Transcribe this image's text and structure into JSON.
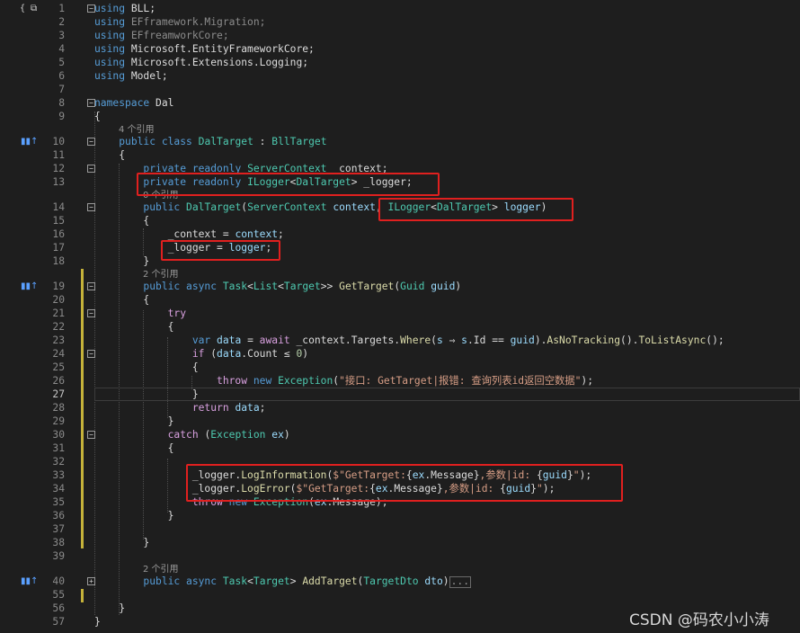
{
  "colors": {
    "background": "#1e1e1e",
    "keyword": "#569cd6",
    "control_keyword": "#d8a0df",
    "type": "#4ec9b0",
    "method": "#dcdcaa",
    "string": "#d69d85",
    "parameter": "#9cdcfe",
    "number": "#b5cea8",
    "highlight_box": "#e0201f"
  },
  "top_icon": "{ ⧉",
  "codelens": {
    "class_refs": "4 个引用",
    "ctor_refs": "0 个引用",
    "method_refs": "2 个引用",
    "add_refs": "2 个引用"
  },
  "lines": [
    {
      "n": "1",
      "t": [
        {
          "c": "kw",
          "v": "using"
        },
        {
          "c": "nm",
          "v": " BLL;"
        }
      ]
    },
    {
      "n": "2",
      "t": [
        {
          "c": "kw",
          "v": "using"
        },
        {
          "c": "gray",
          "v": " EFframework.Migration;"
        }
      ]
    },
    {
      "n": "3",
      "t": [
        {
          "c": "kw",
          "v": "using"
        },
        {
          "c": "gray",
          "v": " EFfreamworkCore;"
        }
      ]
    },
    {
      "n": "4",
      "t": [
        {
          "c": "kw",
          "v": "using"
        },
        {
          "c": "nm",
          "v": " Microsoft.EntityFrameworkCore;"
        }
      ]
    },
    {
      "n": "5",
      "t": [
        {
          "c": "kw",
          "v": "using"
        },
        {
          "c": "nm",
          "v": " Microsoft.Extensions.Logging;"
        }
      ]
    },
    {
      "n": "6",
      "t": [
        {
          "c": "kw",
          "v": "using"
        },
        {
          "c": "nm",
          "v": " Model;"
        }
      ]
    },
    {
      "n": "7",
      "t": []
    },
    {
      "n": "8",
      "t": [
        {
          "c": "kw",
          "v": "namespace"
        },
        {
          "c": "nm",
          "v": " Dal"
        }
      ]
    },
    {
      "n": "9",
      "t": [
        {
          "c": "nm",
          "v": "{"
        }
      ]
    },
    {
      "n": "10",
      "t": [
        {
          "c": "nm",
          "v": "    "
        },
        {
          "c": "kw",
          "v": "public class"
        },
        {
          "c": "nm",
          "v": " "
        },
        {
          "c": "ty",
          "v": "DalTarget"
        },
        {
          "c": "nm",
          "v": " : "
        },
        {
          "c": "ty",
          "v": "BllTarget"
        }
      ]
    },
    {
      "n": "11",
      "t": [
        {
          "c": "nm",
          "v": "    {"
        }
      ]
    },
    {
      "n": "12",
      "t": [
        {
          "c": "nm",
          "v": "        "
        },
        {
          "c": "kw",
          "v": "private readonly"
        },
        {
          "c": "nm",
          "v": " "
        },
        {
          "c": "ty",
          "v": "ServerContext"
        },
        {
          "c": "nm",
          "v": " _context;"
        }
      ]
    },
    {
      "n": "13",
      "t": [
        {
          "c": "nm",
          "v": "        "
        },
        {
          "c": "kw",
          "v": "private readonly"
        },
        {
          "c": "nm",
          "v": " "
        },
        {
          "c": "ty",
          "v": "ILogger"
        },
        {
          "c": "nm",
          "v": "<"
        },
        {
          "c": "ty",
          "v": "DalTarget"
        },
        {
          "c": "nm",
          "v": "> _logger;"
        }
      ]
    },
    {
      "n": "14",
      "t": [
        {
          "c": "nm",
          "v": "        "
        },
        {
          "c": "kw",
          "v": "public"
        },
        {
          "c": "nm",
          "v": " "
        },
        {
          "c": "ty",
          "v": "DalTarget"
        },
        {
          "c": "nm",
          "v": "("
        },
        {
          "c": "ty",
          "v": "ServerContext"
        },
        {
          "c": "nm",
          "v": " "
        },
        {
          "c": "pm",
          "v": "context"
        },
        {
          "c": "nm",
          "v": ", "
        },
        {
          "c": "ty",
          "v": "ILogger"
        },
        {
          "c": "nm",
          "v": "<"
        },
        {
          "c": "ty",
          "v": "DalTarget"
        },
        {
          "c": "nm",
          "v": "> "
        },
        {
          "c": "pm",
          "v": "logger"
        },
        {
          "c": "nm",
          "v": ")"
        }
      ]
    },
    {
      "n": "15",
      "t": [
        {
          "c": "nm",
          "v": "        {"
        }
      ]
    },
    {
      "n": "16",
      "t": [
        {
          "c": "nm",
          "v": "            _context = "
        },
        {
          "c": "pm",
          "v": "context"
        },
        {
          "c": "nm",
          "v": ";"
        }
      ]
    },
    {
      "n": "17",
      "t": [
        {
          "c": "nm",
          "v": "            _logger = "
        },
        {
          "c": "pm",
          "v": "logger"
        },
        {
          "c": "nm",
          "v": ";"
        }
      ]
    },
    {
      "n": "18",
      "t": [
        {
          "c": "nm",
          "v": "        }"
        }
      ]
    },
    {
      "n": "19",
      "t": [
        {
          "c": "nm",
          "v": "        "
        },
        {
          "c": "kw",
          "v": "public async"
        },
        {
          "c": "nm",
          "v": " "
        },
        {
          "c": "ty",
          "v": "Task"
        },
        {
          "c": "nm",
          "v": "<"
        },
        {
          "c": "ty",
          "v": "List"
        },
        {
          "c": "nm",
          "v": "<"
        },
        {
          "c": "ty",
          "v": "Target"
        },
        {
          "c": "nm",
          "v": ">> "
        },
        {
          "c": "fn",
          "v": "GetTarget"
        },
        {
          "c": "nm",
          "v": "("
        },
        {
          "c": "ty",
          "v": "Guid"
        },
        {
          "c": "nm",
          "v": " "
        },
        {
          "c": "pm",
          "v": "guid"
        },
        {
          "c": "nm",
          "v": ")"
        }
      ]
    },
    {
      "n": "20",
      "t": [
        {
          "c": "nm",
          "v": "        {"
        }
      ]
    },
    {
      "n": "21",
      "t": [
        {
          "c": "nm",
          "v": "            "
        },
        {
          "c": "ctl",
          "v": "try"
        }
      ]
    },
    {
      "n": "22",
      "t": [
        {
          "c": "nm",
          "v": "            {"
        }
      ]
    },
    {
      "n": "23",
      "t": [
        {
          "c": "nm",
          "v": "                "
        },
        {
          "c": "kw",
          "v": "var"
        },
        {
          "c": "nm",
          "v": " "
        },
        {
          "c": "pm",
          "v": "data"
        },
        {
          "c": "nm",
          "v": " = "
        },
        {
          "c": "ctl",
          "v": "await"
        },
        {
          "c": "nm",
          "v": " _context.Targets."
        },
        {
          "c": "fn",
          "v": "Where"
        },
        {
          "c": "nm",
          "v": "("
        },
        {
          "c": "pm",
          "v": "s"
        },
        {
          "c": "nm",
          "v": " ⇒ "
        },
        {
          "c": "pm",
          "v": "s"
        },
        {
          "c": "nm",
          "v": ".Id == "
        },
        {
          "c": "pm",
          "v": "guid"
        },
        {
          "c": "nm",
          "v": ")."
        },
        {
          "c": "fn",
          "v": "AsNoTracking"
        },
        {
          "c": "nm",
          "v": "()."
        },
        {
          "c": "fn",
          "v": "ToListAsync"
        },
        {
          "c": "nm",
          "v": "();"
        }
      ]
    },
    {
      "n": "24",
      "t": [
        {
          "c": "nm",
          "v": "                "
        },
        {
          "c": "ctl",
          "v": "if"
        },
        {
          "c": "nm",
          "v": " ("
        },
        {
          "c": "pm",
          "v": "data"
        },
        {
          "c": "nm",
          "v": ".Count ≤ "
        },
        {
          "c": "num",
          "v": "0"
        },
        {
          "c": "nm",
          "v": ")"
        }
      ]
    },
    {
      "n": "25",
      "t": [
        {
          "c": "nm",
          "v": "                {"
        }
      ]
    },
    {
      "n": "26",
      "t": [
        {
          "c": "nm",
          "v": "                    "
        },
        {
          "c": "ctl",
          "v": "throw"
        },
        {
          "c": "nm",
          "v": " "
        },
        {
          "c": "kw",
          "v": "new"
        },
        {
          "c": "nm",
          "v": " "
        },
        {
          "c": "ty",
          "v": "Exception"
        },
        {
          "c": "nm",
          "v": "("
        },
        {
          "c": "str",
          "v": "\"接口: GetTarget|报错: 查询列表id返回空数据\""
        },
        {
          "c": "nm",
          "v": ");"
        }
      ]
    },
    {
      "n": "27",
      "t": [
        {
          "c": "nm",
          "v": "                }"
        }
      ]
    },
    {
      "n": "28",
      "t": [
        {
          "c": "nm",
          "v": "                "
        },
        {
          "c": "ctl",
          "v": "return"
        },
        {
          "c": "nm",
          "v": " "
        },
        {
          "c": "pm",
          "v": "data"
        },
        {
          "c": "nm",
          "v": ";"
        }
      ]
    },
    {
      "n": "29",
      "t": [
        {
          "c": "nm",
          "v": "            }"
        }
      ]
    },
    {
      "n": "30",
      "t": [
        {
          "c": "nm",
          "v": "            "
        },
        {
          "c": "ctl",
          "v": "catch"
        },
        {
          "c": "nm",
          "v": " ("
        },
        {
          "c": "ty",
          "v": "Exception"
        },
        {
          "c": "nm",
          "v": " "
        },
        {
          "c": "pm",
          "v": "ex"
        },
        {
          "c": "nm",
          "v": ")"
        }
      ]
    },
    {
      "n": "31",
      "t": [
        {
          "c": "nm",
          "v": "            {"
        }
      ]
    },
    {
      "n": "32",
      "t": []
    },
    {
      "n": "33",
      "t": [
        {
          "c": "nm",
          "v": "                _logger."
        },
        {
          "c": "fn",
          "v": "LogInformation"
        },
        {
          "c": "nm",
          "v": "("
        },
        {
          "c": "str",
          "v": "$\"GetTarget:"
        },
        {
          "c": "nm",
          "v": "{"
        },
        {
          "c": "pm",
          "v": "ex"
        },
        {
          "c": "nm",
          "v": ".Message}"
        },
        {
          "c": "str",
          "v": ",参数|id: "
        },
        {
          "c": "nm",
          "v": "{"
        },
        {
          "c": "pm",
          "v": "guid"
        },
        {
          "c": "nm",
          "v": "}"
        },
        {
          "c": "str",
          "v": "\""
        },
        {
          "c": "nm",
          "v": ");"
        }
      ]
    },
    {
      "n": "34",
      "t": [
        {
          "c": "nm",
          "v": "                _logger."
        },
        {
          "c": "fn",
          "v": "LogError"
        },
        {
          "c": "nm",
          "v": "("
        },
        {
          "c": "str",
          "v": "$\"GetTarget:"
        },
        {
          "c": "nm",
          "v": "{"
        },
        {
          "c": "pm",
          "v": "ex"
        },
        {
          "c": "nm",
          "v": ".Message}"
        },
        {
          "c": "str",
          "v": ",参数|id: "
        },
        {
          "c": "nm",
          "v": "{"
        },
        {
          "c": "pm",
          "v": "guid"
        },
        {
          "c": "nm",
          "v": "}"
        },
        {
          "c": "str",
          "v": "\""
        },
        {
          "c": "nm",
          "v": ");"
        }
      ]
    },
    {
      "n": "35",
      "t": [
        {
          "c": "nm",
          "v": "                "
        },
        {
          "c": "ctl",
          "v": "throw"
        },
        {
          "c": "nm",
          "v": " "
        },
        {
          "c": "kw",
          "v": "new"
        },
        {
          "c": "nm",
          "v": " "
        },
        {
          "c": "ty",
          "v": "Exception"
        },
        {
          "c": "nm",
          "v": "("
        },
        {
          "c": "pm",
          "v": "ex"
        },
        {
          "c": "nm",
          "v": ".Message);"
        }
      ]
    },
    {
      "n": "36",
      "t": [
        {
          "c": "nm",
          "v": "            }"
        }
      ]
    },
    {
      "n": "37",
      "t": []
    },
    {
      "n": "38",
      "t": [
        {
          "c": "nm",
          "v": "        }"
        }
      ]
    },
    {
      "n": "39",
      "t": []
    },
    {
      "n": "40",
      "t": [
        {
          "c": "nm",
          "v": "        "
        },
        {
          "c": "kw",
          "v": "public async"
        },
        {
          "c": "nm",
          "v": " "
        },
        {
          "c": "ty",
          "v": "Task"
        },
        {
          "c": "nm",
          "v": "<"
        },
        {
          "c": "ty",
          "v": "Target"
        },
        {
          "c": "nm",
          "v": "> "
        },
        {
          "c": "fn",
          "v": "AddTarget"
        },
        {
          "c": "nm",
          "v": "("
        },
        {
          "c": "ty",
          "v": "TargetDto"
        },
        {
          "c": "nm",
          "v": " "
        },
        {
          "c": "pm",
          "v": "dto"
        },
        {
          "c": "nm",
          "v": ")"
        }
      ]
    },
    {
      "n": "55",
      "t": []
    },
    {
      "n": "56",
      "t": [
        {
          "c": "nm",
          "v": "    }"
        }
      ]
    },
    {
      "n": "57",
      "t": [
        {
          "c": "nm",
          "v": "}"
        }
      ]
    }
  ],
  "collapsed_marker": "...",
  "watermark": "CSDN @码农小小涛"
}
